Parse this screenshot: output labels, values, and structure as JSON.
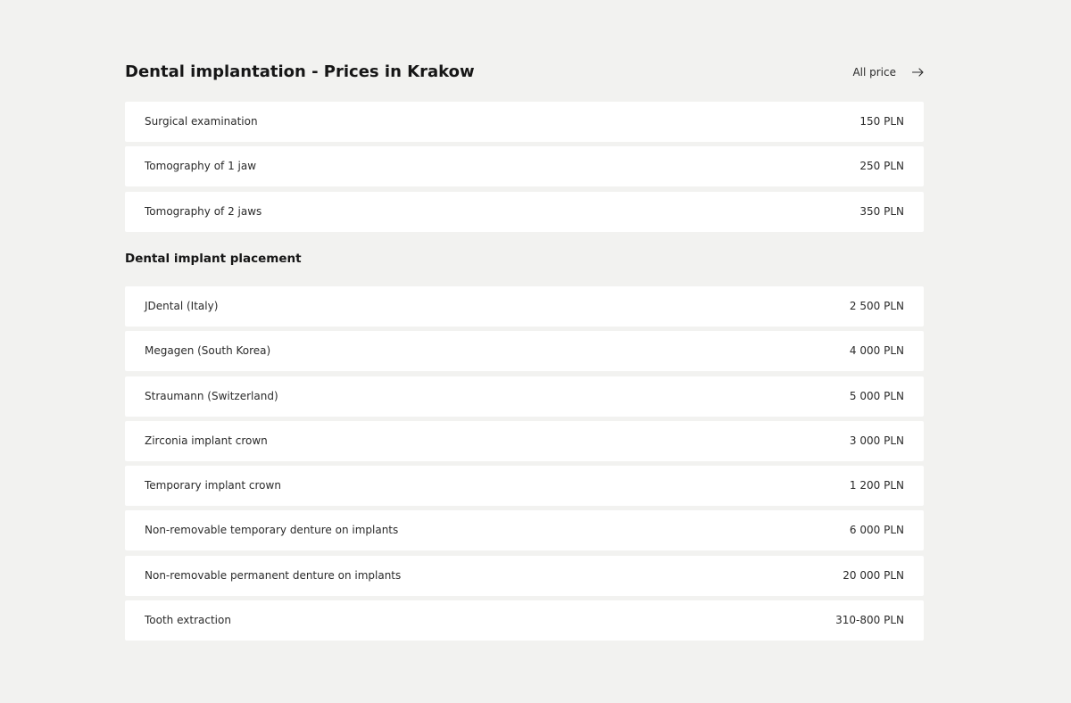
{
  "header": {
    "title": "Dental implantation - Prices in Krakow",
    "all_price_label": "All price",
    "link_icon": "arrow-right-icon"
  },
  "section_1": {
    "items": [
      {
        "name": "Surgical examination",
        "price": "150 PLN"
      },
      {
        "name": "Tomography of 1 jaw",
        "price": "250 PLN"
      },
      {
        "name": "Tomography of 2 jaws",
        "price": "350 PLN"
      }
    ]
  },
  "section_2": {
    "title": "Dental implant placement",
    "items": [
      {
        "name": "JDental (Italy)",
        "price": "2 500 PLN"
      },
      {
        "name": "Megagen (South Korea)",
        "price": "4 000 PLN"
      },
      {
        "name": "Straumann (Switzerland)",
        "price": "5 000 PLN"
      },
      {
        "name": "Zirconia implant crown",
        "price": "3 000 PLN"
      },
      {
        "name": "Temporary implant crown",
        "price": "1 200 PLN"
      },
      {
        "name": "Non-removable temporary denture on implants",
        "price": "6 000 PLN"
      },
      {
        "name": "Non-removable permanent denture on implants",
        "price": "20 000 PLN"
      },
      {
        "name": "Tooth extraction",
        "price": "310-800 PLN"
      }
    ]
  },
  "colors": {
    "background": "#f2f2f0",
    "row_background": "#ffffff",
    "text": "#1e1e1e"
  }
}
